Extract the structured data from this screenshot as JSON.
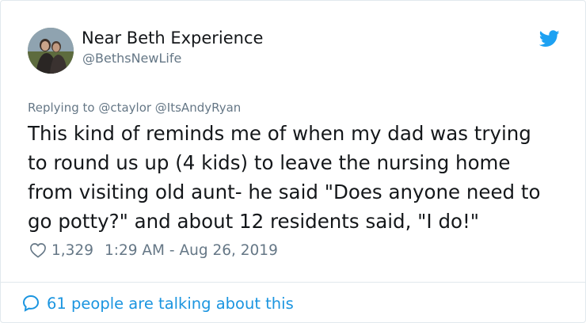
{
  "author": {
    "display_name": "Near Beth Experience",
    "handle": "@BethsNewLife"
  },
  "icons": {
    "brand": "twitter-bird-icon",
    "like": "heart-outline-icon",
    "conversation": "speech-bubble-icon"
  },
  "tweet": {
    "replying_to": "Replying to @ctaylor @ItsAndyRyan",
    "text": "This kind of reminds me of when my dad was trying\nto round us up (4 kids) to leave the nursing home\nfrom visiting old aunt- he said \"Does anyone need to\ngo potty?\" and about 12 residents said, \"I do!\"",
    "like_count": "1,329",
    "timestamp": "1:29 AM - Aug 26, 2019"
  },
  "footer": {
    "conversation_label": "61 people are talking about this"
  },
  "colors": {
    "text": "#14171a",
    "secondary": "#657786",
    "accent": "#1b95e0",
    "brand": "#1da1f2",
    "border": "#e1e8ed"
  }
}
